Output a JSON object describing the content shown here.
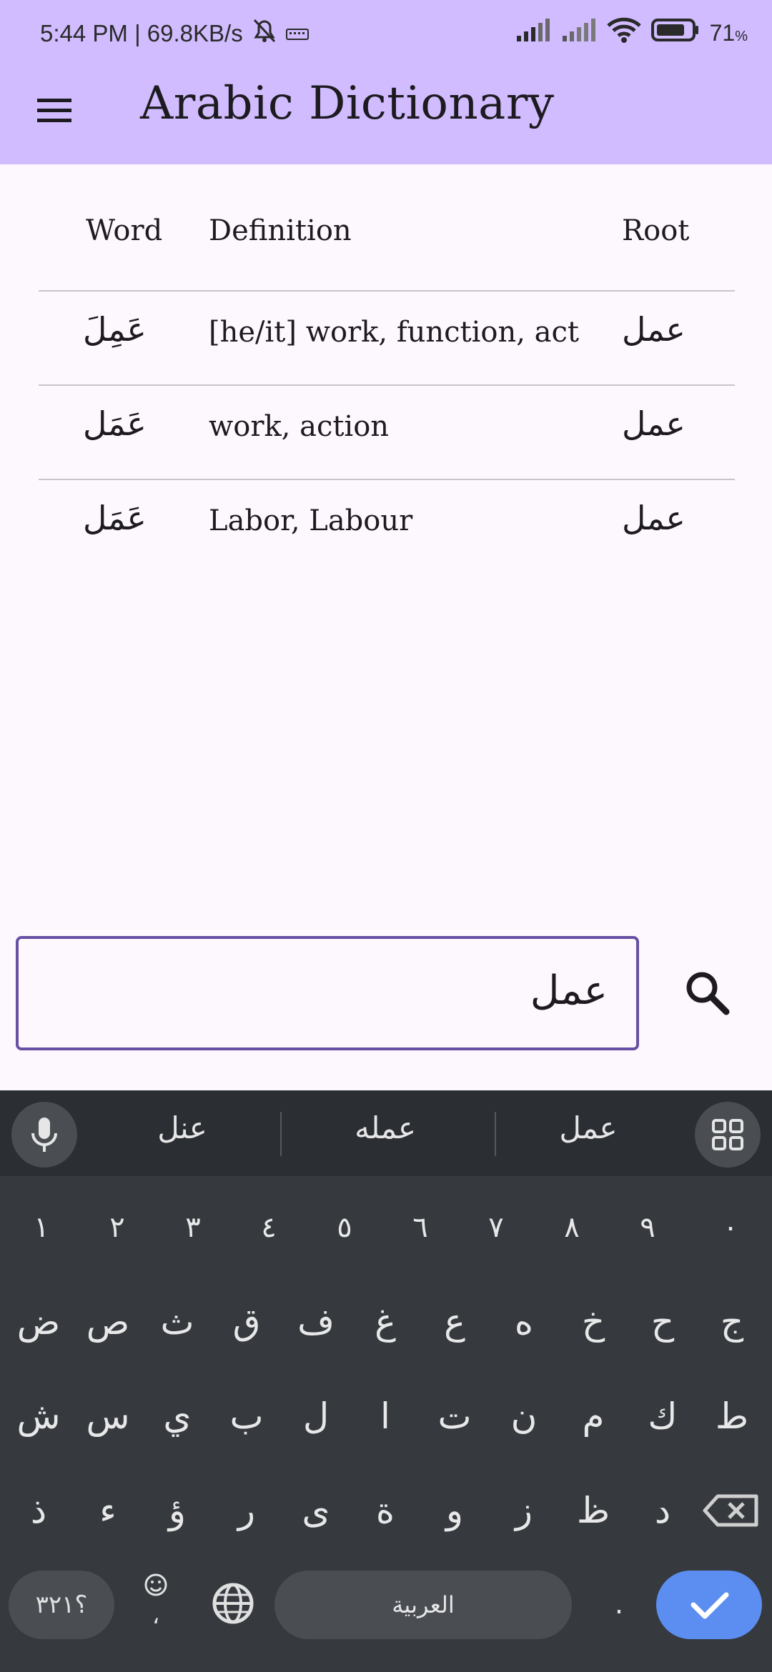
{
  "status_bar": {
    "time_speed": "5:44 PM | 69.8KB/s",
    "battery": "71"
  },
  "app_bar": {
    "title": "Arabic Dictionary"
  },
  "table": {
    "headers": {
      "word": "Word",
      "definition": "Definition",
      "root": "Root"
    },
    "rows": [
      {
        "word": "عَمِلَ",
        "definition": "[he/it] work, function, act",
        "root": "عمل"
      },
      {
        "word": "عَمَل",
        "definition": "work, action",
        "root": "عمل"
      },
      {
        "word": "عَمَل",
        "definition": "Labor, Labour",
        "root": "عمل"
      }
    ]
  },
  "search": {
    "value": "عمل"
  },
  "keyboard": {
    "suggestions": [
      "عنل",
      "عمله",
      "عمل"
    ],
    "digits": [
      "١",
      "٢",
      "٣",
      "٤",
      "٥",
      "٦",
      "٧",
      "٨",
      "٩",
      "٠"
    ],
    "row1": [
      "ض",
      "ص",
      "ث",
      "ق",
      "ف",
      "غ",
      "ع",
      "ه",
      "خ",
      "ح",
      "ج"
    ],
    "row2": [
      "ش",
      "س",
      "ي",
      "ب",
      "ل",
      "ا",
      "ت",
      "ن",
      "م",
      "ك",
      "ط"
    ],
    "row3": [
      "ذ",
      "ء",
      "ؤ",
      "ر",
      "ى",
      "ة",
      "و",
      "ز",
      "ظ",
      "د"
    ],
    "symbols_key": "؟٣٢١",
    "space_label": "العربية",
    "comma": "،",
    "period": "."
  }
}
